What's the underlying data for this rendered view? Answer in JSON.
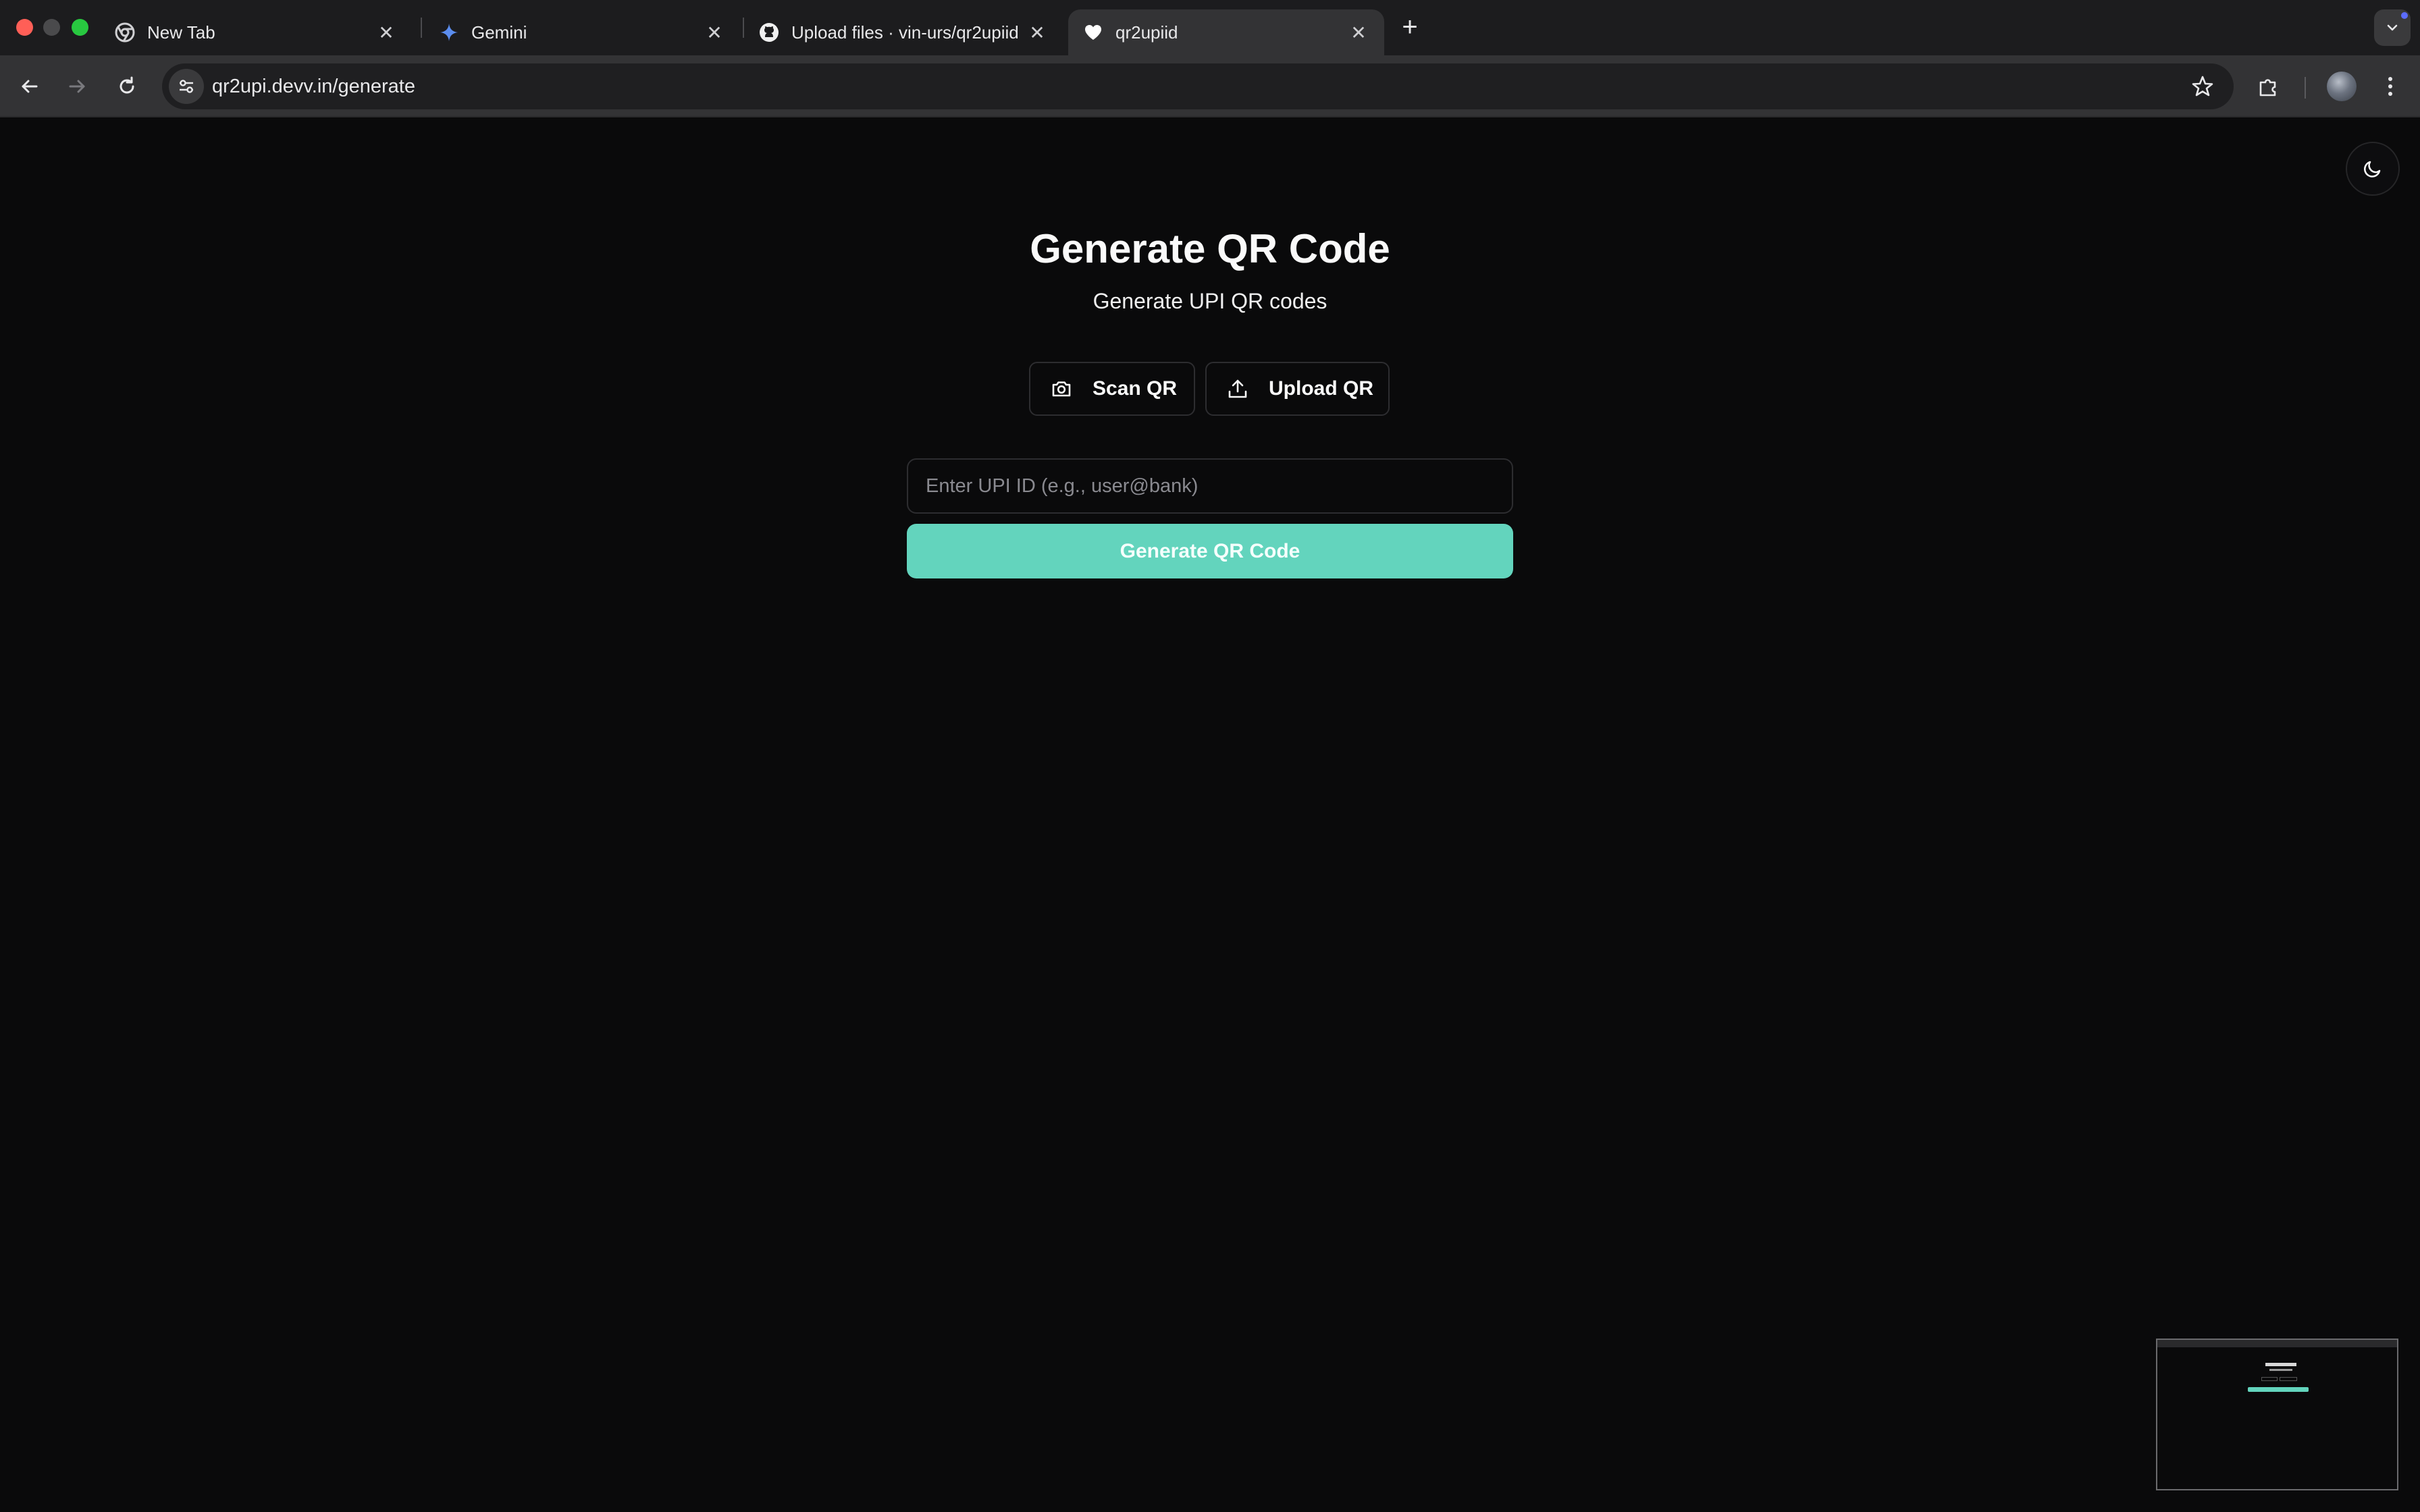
{
  "browser": {
    "tabs": [
      {
        "label": "New Tab",
        "icon": "chrome-icon"
      },
      {
        "label": "Gemini",
        "icon": "gemini-icon"
      },
      {
        "label": "Upload files · vin-urs/qr2upiid",
        "icon": "github-icon"
      },
      {
        "label": "qr2upiid",
        "icon": "heart-icon",
        "active": true
      }
    ],
    "url": "qr2upi.devv.in/generate"
  },
  "page": {
    "title": "Generate QR Code",
    "subtitle": "Generate UPI QR codes",
    "scan_label": "Scan QR",
    "upload_label": "Upload QR",
    "upi_placeholder": "Enter UPI ID (e.g., user@bank)",
    "upi_value": "",
    "generate_label": "Generate QR Code"
  },
  "colors": {
    "background": "#0a0a0b",
    "accent": "#63d4bd"
  }
}
